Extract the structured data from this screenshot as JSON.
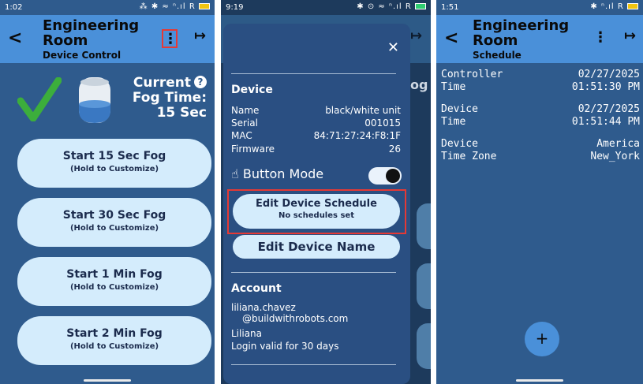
{
  "panel1": {
    "status": {
      "time": "1:02",
      "icons": "⁂ ✱ ≈ ⁿ.ıl R"
    },
    "appbar": {
      "title_line1": "Engineering",
      "title_line2": "Room",
      "subtitle": "Device Control"
    },
    "fog_time": {
      "line1": "Current",
      "line2": "Fog Time:",
      "line3": "15 Sec",
      "help": "?"
    },
    "buttons": [
      {
        "label": "Start 15 Sec Fog",
        "hint": "(Hold to Customize)"
      },
      {
        "label": "Start 30 Sec Fog",
        "hint": "(Hold to Customize)"
      },
      {
        "label": "Start 1 Min Fog",
        "hint": "(Hold to Customize)"
      },
      {
        "label": "Start 2 Min Fog",
        "hint": "(Hold to Customize)"
      }
    ],
    "colors": {
      "accent": "#4a90d9",
      "background": "#2f5b8d",
      "button": "#d4ecfc",
      "check": "#3cae3c"
    }
  },
  "panel2": {
    "status": {
      "time": "9:19",
      "icons": "✱ ⊙ ≈ ⁿ.ıl R"
    },
    "background_hint": "og",
    "close": "✕",
    "device": {
      "title": "Device",
      "rows": [
        {
          "key": "Name",
          "value": "black/white unit"
        },
        {
          "key": "Serial",
          "value": "001015"
        },
        {
          "key": "MAC",
          "value": "84:71:27:24:F8:1F"
        },
        {
          "key": "Firmware",
          "value": "26"
        }
      ],
      "button_mode_label": "Button Mode",
      "button_mode_on": true
    },
    "edit_schedule": {
      "label": "Edit Device Schedule",
      "sub": "No schedules set"
    },
    "edit_name": {
      "label": "Edit Device Name"
    },
    "account": {
      "title": "Account",
      "email_line1": "liliana.chavez",
      "email_line2": "@buildwithrobots.com",
      "name": "Liliana",
      "login": "Login valid for 30 days"
    }
  },
  "panel3": {
    "status": {
      "time": "1:51",
      "icons": "✱ ⁿ.ıl R"
    },
    "appbar": {
      "title_line1": "Engineering",
      "title_line2": "Room",
      "subtitle": "Schedule"
    },
    "entries": [
      {
        "k1": "Controller",
        "k2": "Time",
        "v1": "02/27/2025",
        "v2": "01:51:30 PM"
      },
      {
        "k1": "Device",
        "k2": "Time",
        "v1": "02/27/2025",
        "v2": "01:51:44 PM"
      },
      {
        "k1": "Device",
        "k2": "Time Zone",
        "v1": "America",
        "v2": "New_York"
      }
    ],
    "fab": "+"
  }
}
